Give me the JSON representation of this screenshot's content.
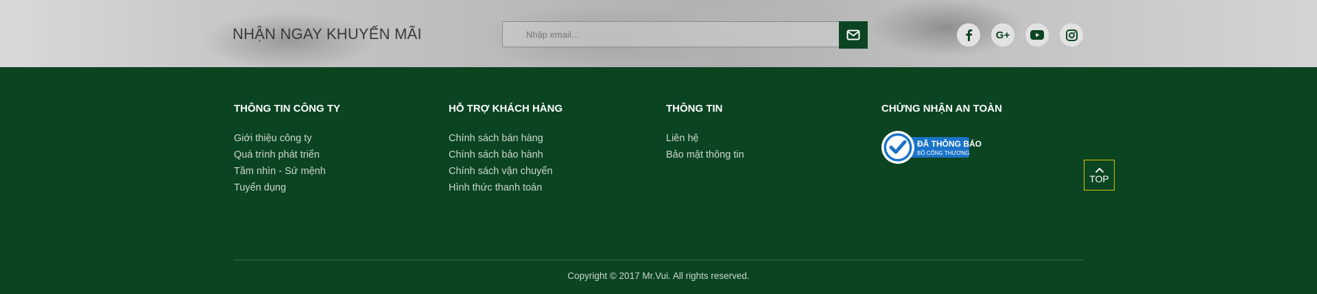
{
  "newsletter": {
    "title": "NHẬN NGAY KHUYẾN MÃI",
    "email_placeholder": "Nhập email...",
    "submit_icon": "envelope-icon"
  },
  "social": [
    {
      "name": "facebook-icon"
    },
    {
      "name": "google-plus-icon",
      "label": "G+"
    },
    {
      "name": "youtube-icon"
    },
    {
      "name": "instagram-icon"
    }
  ],
  "columns": [
    {
      "title": "THÔNG TIN CÔNG TY",
      "links": [
        "Giới thiệu công ty",
        "Quá trình phát triển",
        "Tầm nhìn - Sứ mệnh",
        "Tuyển dụng"
      ]
    },
    {
      "title": "HỖ TRỢ KHÁCH HÀNG",
      "links": [
        "Chính sách bán hàng",
        "Chính sách bảo hành",
        "Chính sách vận chuyển",
        "Hình thức thanh toán"
      ]
    },
    {
      "title": "THÔNG TIN",
      "links": [
        "Liên hệ",
        "Bảo mật thông tin"
      ]
    },
    {
      "title": "CHỨNG NHẬN AN TOÀN",
      "links": []
    }
  ],
  "badge": {
    "line1": "ĐÃ THÔNG BÁO",
    "line2": "BỘ CÔNG THƯƠNG"
  },
  "top_button": {
    "label": "TOP"
  },
  "copyright": "Copyright © 2017 Mr.Vui. All rights reserved.",
  "colors": {
    "footer_bg": "#0a4421",
    "accent_border": "#e2c400",
    "badge_blue": "#1a73c8"
  }
}
